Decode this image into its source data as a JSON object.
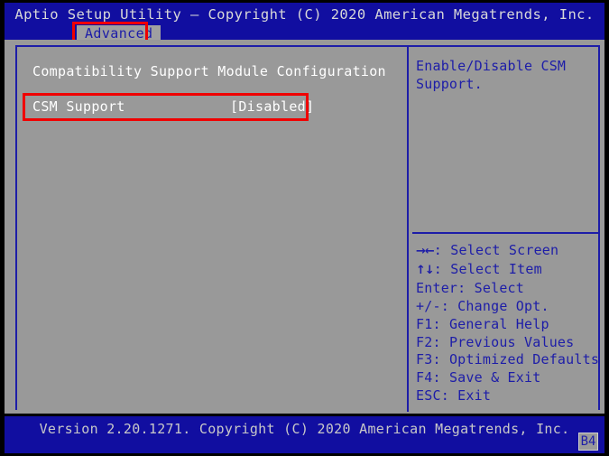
{
  "screen": {
    "title": "Aptio Setup Utility – Copyright (C) 2020 American Megatrends, Inc.",
    "colors": {
      "background_blue": "#110ea0",
      "panel_gray": "#999999",
      "accent_blue": "#1d1da8",
      "text_white": "#ffffff",
      "highlight_red": "#f00000"
    }
  },
  "menu_bar": {
    "tabs": [
      {
        "label": "Advanced",
        "selected": true,
        "annotated": true
      }
    ]
  },
  "main": {
    "section_heading": "Compatibility Support Module Configuration",
    "settings": [
      {
        "label": "CSM Support",
        "value": "[Disabled]",
        "selected": true,
        "annotated": true
      }
    ]
  },
  "help_panel": {
    "description": "Enable/Disable CSM Support.",
    "keys": [
      {
        "glyph": "→←",
        "key": "",
        "separator": ": ",
        "action": "Select Screen"
      },
      {
        "glyph": "↑↓",
        "key": "",
        "separator": ": ",
        "action": "Select Item"
      },
      {
        "glyph": "",
        "key": "Enter",
        "separator": ": ",
        "action": "Select"
      },
      {
        "glyph": "",
        "key": "+/-",
        "separator": ": ",
        "action": "Change Opt."
      },
      {
        "glyph": "",
        "key": "F1",
        "separator": ": ",
        "action": "General Help"
      },
      {
        "glyph": "",
        "key": "F2",
        "separator": ": ",
        "action": "Previous Values"
      },
      {
        "glyph": "",
        "key": "F3",
        "separator": ": ",
        "action": "Optimized Defaults"
      },
      {
        "glyph": "",
        "key": "F4",
        "separator": ": ",
        "action": "Save & Exit"
      },
      {
        "glyph": "",
        "key": "ESC",
        "separator": ": ",
        "action": "Exit"
      }
    ]
  },
  "footer": {
    "version_text": "Version 2.20.1271. Copyright (C) 2020 American Megatrends, Inc.",
    "build_badge": "B4"
  }
}
